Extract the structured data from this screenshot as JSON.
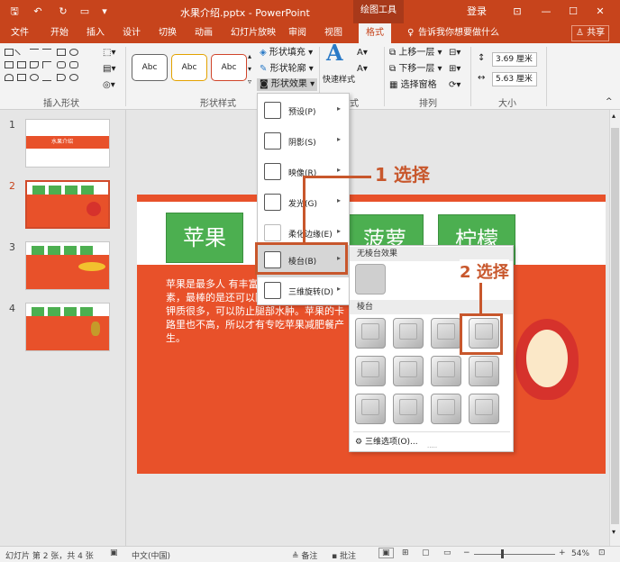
{
  "titlebar": {
    "title": "水果介绍.pptx - PowerPoint",
    "context": "绘图工具",
    "login": "登录"
  },
  "tabs": [
    "文件",
    "开始",
    "插入",
    "设计",
    "切换",
    "动画",
    "幻灯片放映",
    "审阅",
    "视图",
    "格式"
  ],
  "tell_me": "告诉我你想要做什么",
  "share": "共享",
  "ribbon": {
    "groups": {
      "insert_shapes": "插入形状",
      "shape_styles": "形状样式",
      "art_styles": "艺术字样式",
      "arrange": "排列",
      "size": "大小"
    },
    "style_sample": "Abc",
    "fill": "形状填充",
    "outline": "形状轮廓",
    "effects": "形状效果",
    "quick_styles": "快速样式",
    "arrange_items": [
      "上移一层",
      "下移一层",
      "选择窗格"
    ],
    "height": "3.69 厘米",
    "width": "5.63 厘米"
  },
  "slides": [
    "1",
    "2",
    "3",
    "4"
  ],
  "thumb1_title": "水果介绍",
  "slide": {
    "boxes": [
      "苹果",
      "菠萝",
      "柠檬"
    ],
    "text": "苹果是最多人 有丰富的果胶，可以 毒素，最棒的是还可以降低胆固醇，苹果的钾质很多，可以防止腿部水肿。苹果的卡路里也不高，所以才有专吃苹果减肥餐产生。"
  },
  "menu": {
    "items": [
      "预设(P)",
      "阴影(S)",
      "映像(R)",
      "发光(G)",
      "柔化边缘(E)",
      "棱台(B)",
      "三维旋转(D)"
    ]
  },
  "bevel_panel": {
    "none_header": "无棱台效果",
    "bevel_header": "棱台",
    "options": "三维选项(O)..."
  },
  "callouts": {
    "step1": "1 选择",
    "step2": "2 选择"
  },
  "status": {
    "slide_info": "幻灯片 第 2 张，共 4 张",
    "lang": "中文(中国)",
    "notes": "备注",
    "comments": "批注",
    "zoom": "54%"
  },
  "colors": {
    "accent": "#c7441c",
    "green": "#4caf50",
    "orange": "#e8512a"
  }
}
